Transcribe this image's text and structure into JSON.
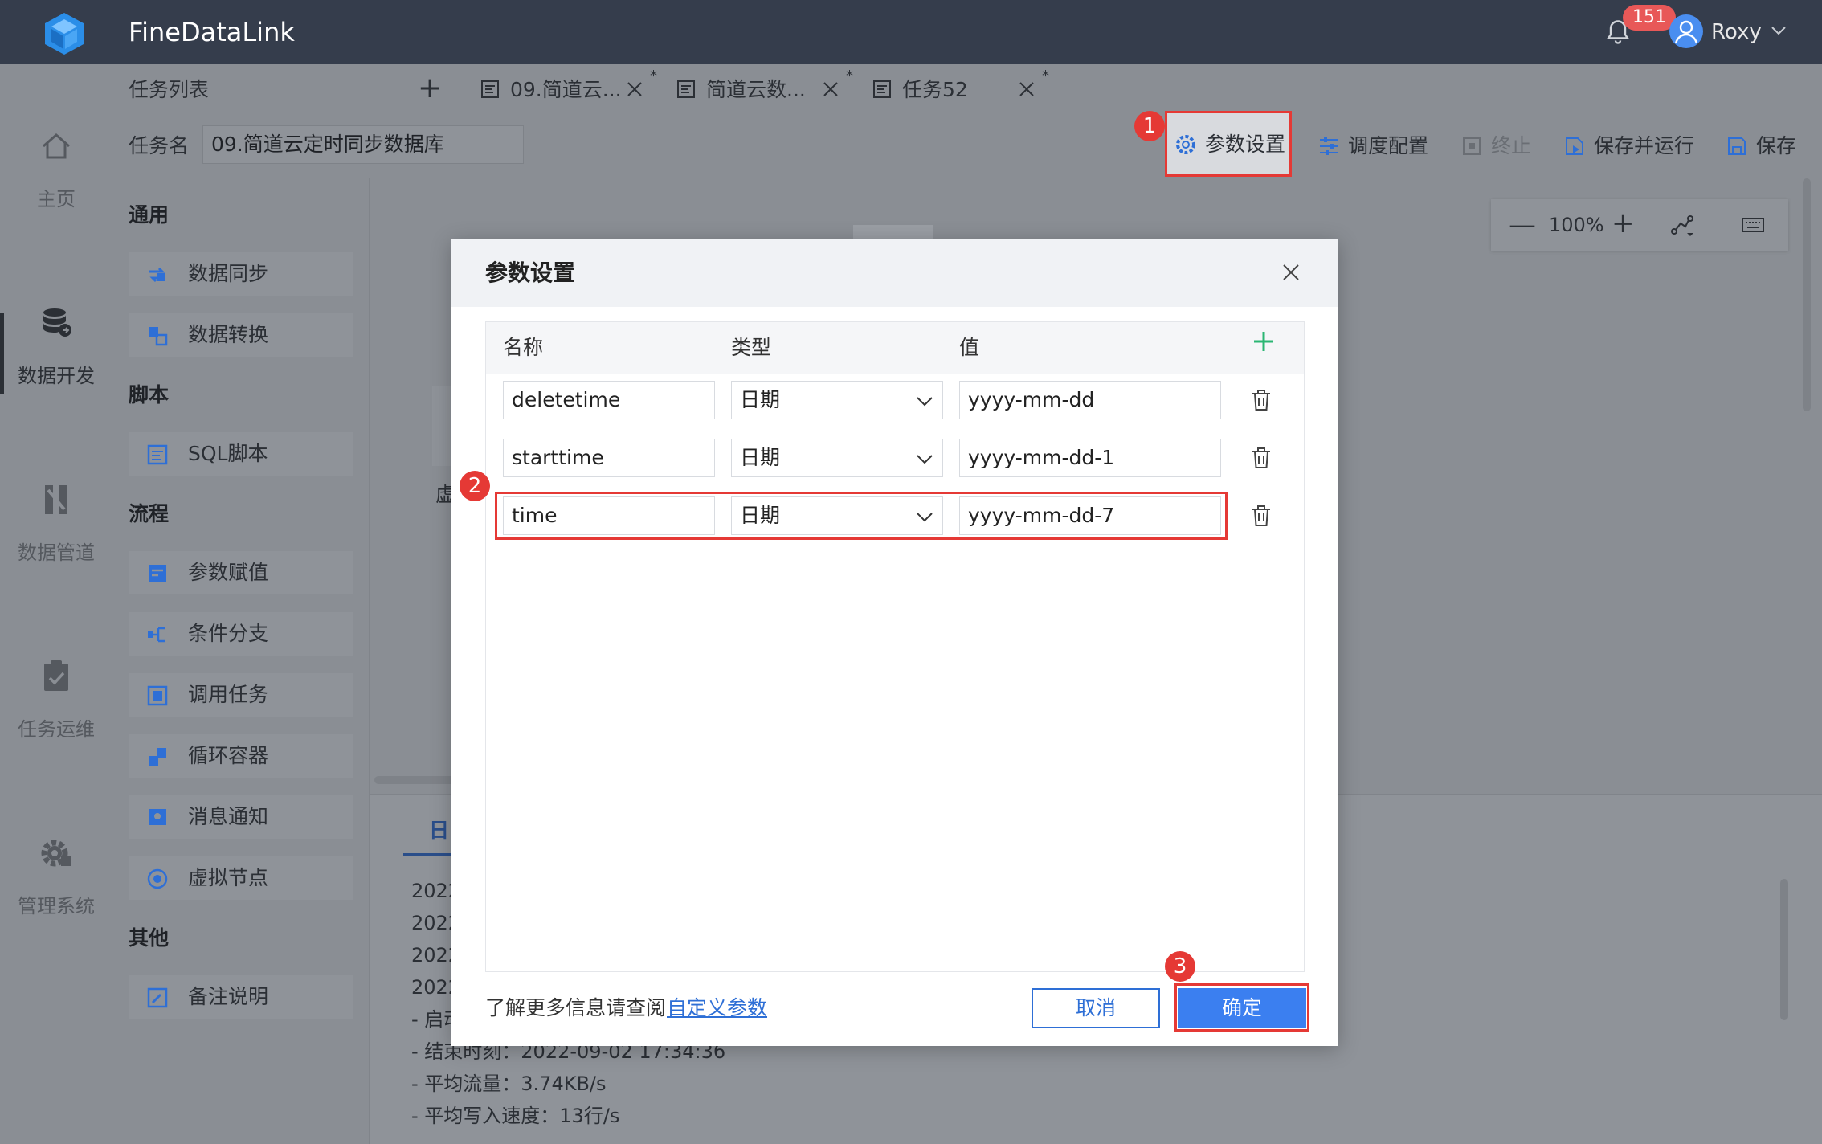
{
  "app": {
    "brand": "FineDataLink",
    "notification_count": "151",
    "user_name": "Roxy"
  },
  "left_nav": [
    {
      "label": "主页",
      "icon": "home-icon"
    },
    {
      "label": "数据开发",
      "icon": "database-icon"
    },
    {
      "label": "数据管道",
      "icon": "pipeline-icon"
    },
    {
      "label": "任务运维",
      "icon": "clipboard-check-icon"
    },
    {
      "label": "管理系统",
      "icon": "gear-icon"
    }
  ],
  "tabs": {
    "task_list_label": "任务列表",
    "add_symbol": "+",
    "items": [
      {
        "label": "09.简道云...",
        "modified": "*"
      },
      {
        "label": "简道云数...",
        "modified": "*"
      },
      {
        "label": "任务52",
        "modified": "*"
      }
    ]
  },
  "toolbar": {
    "task_name_label": "任务名",
    "task_name_value": "09.简道云定时同步数据库",
    "param_settings": "参数设置",
    "schedule_config": "调度配置",
    "stop": "终止",
    "save_and_run": "保存并运行",
    "save": "保存"
  },
  "palette": {
    "groups": [
      {
        "title": "通用",
        "items": [
          "数据同步",
          "数据转换"
        ]
      },
      {
        "title": "脚本",
        "items": [
          "SQL脚本"
        ]
      },
      {
        "title": "流程",
        "items": [
          "参数赋值",
          "条件分支",
          "调用任务",
          "循环容器",
          "消息通知",
          "虚拟节点"
        ]
      },
      {
        "title": "其他",
        "items": [
          "备注说明"
        ]
      }
    ]
  },
  "canvas": {
    "zoom": "100%",
    "zoom_minus": "—",
    "zoom_plus": "+",
    "node_fragment": "虚"
  },
  "log": {
    "tab_label": "日",
    "lines": [
      "2022",
      "2022",
      "2022",
      "2022",
      "- 启动",
      "- 结束时刻：2022-09-02 17:34:36",
      "- 平均流量：3.74KB/s",
      "- 平均写入速度：13行/s"
    ]
  },
  "modal": {
    "title": "参数设置",
    "columns": {
      "name": "名称",
      "type": "类型",
      "value": "值"
    },
    "add_symbol": "+",
    "rows": [
      {
        "name": "deletetime",
        "type": "日期",
        "value": "yyyy-mm-dd"
      },
      {
        "name": "starttime",
        "type": "日期",
        "value": "yyyy-mm-dd-1"
      },
      {
        "name": "time",
        "type": "日期",
        "value": "yyyy-mm-dd-7"
      }
    ],
    "footer_text": "了解更多信息请查阅",
    "footer_link": "自定义参数",
    "cancel": "取消",
    "confirm": "确定"
  },
  "annotations": {
    "step1": "1",
    "step2": "2",
    "step3": "3",
    "highlight_color": "#e53935"
  },
  "colors": {
    "topbar": "#353d4c",
    "primary": "#3b7ff0",
    "link": "#2e6fd6",
    "add_green": "#2bb673"
  }
}
